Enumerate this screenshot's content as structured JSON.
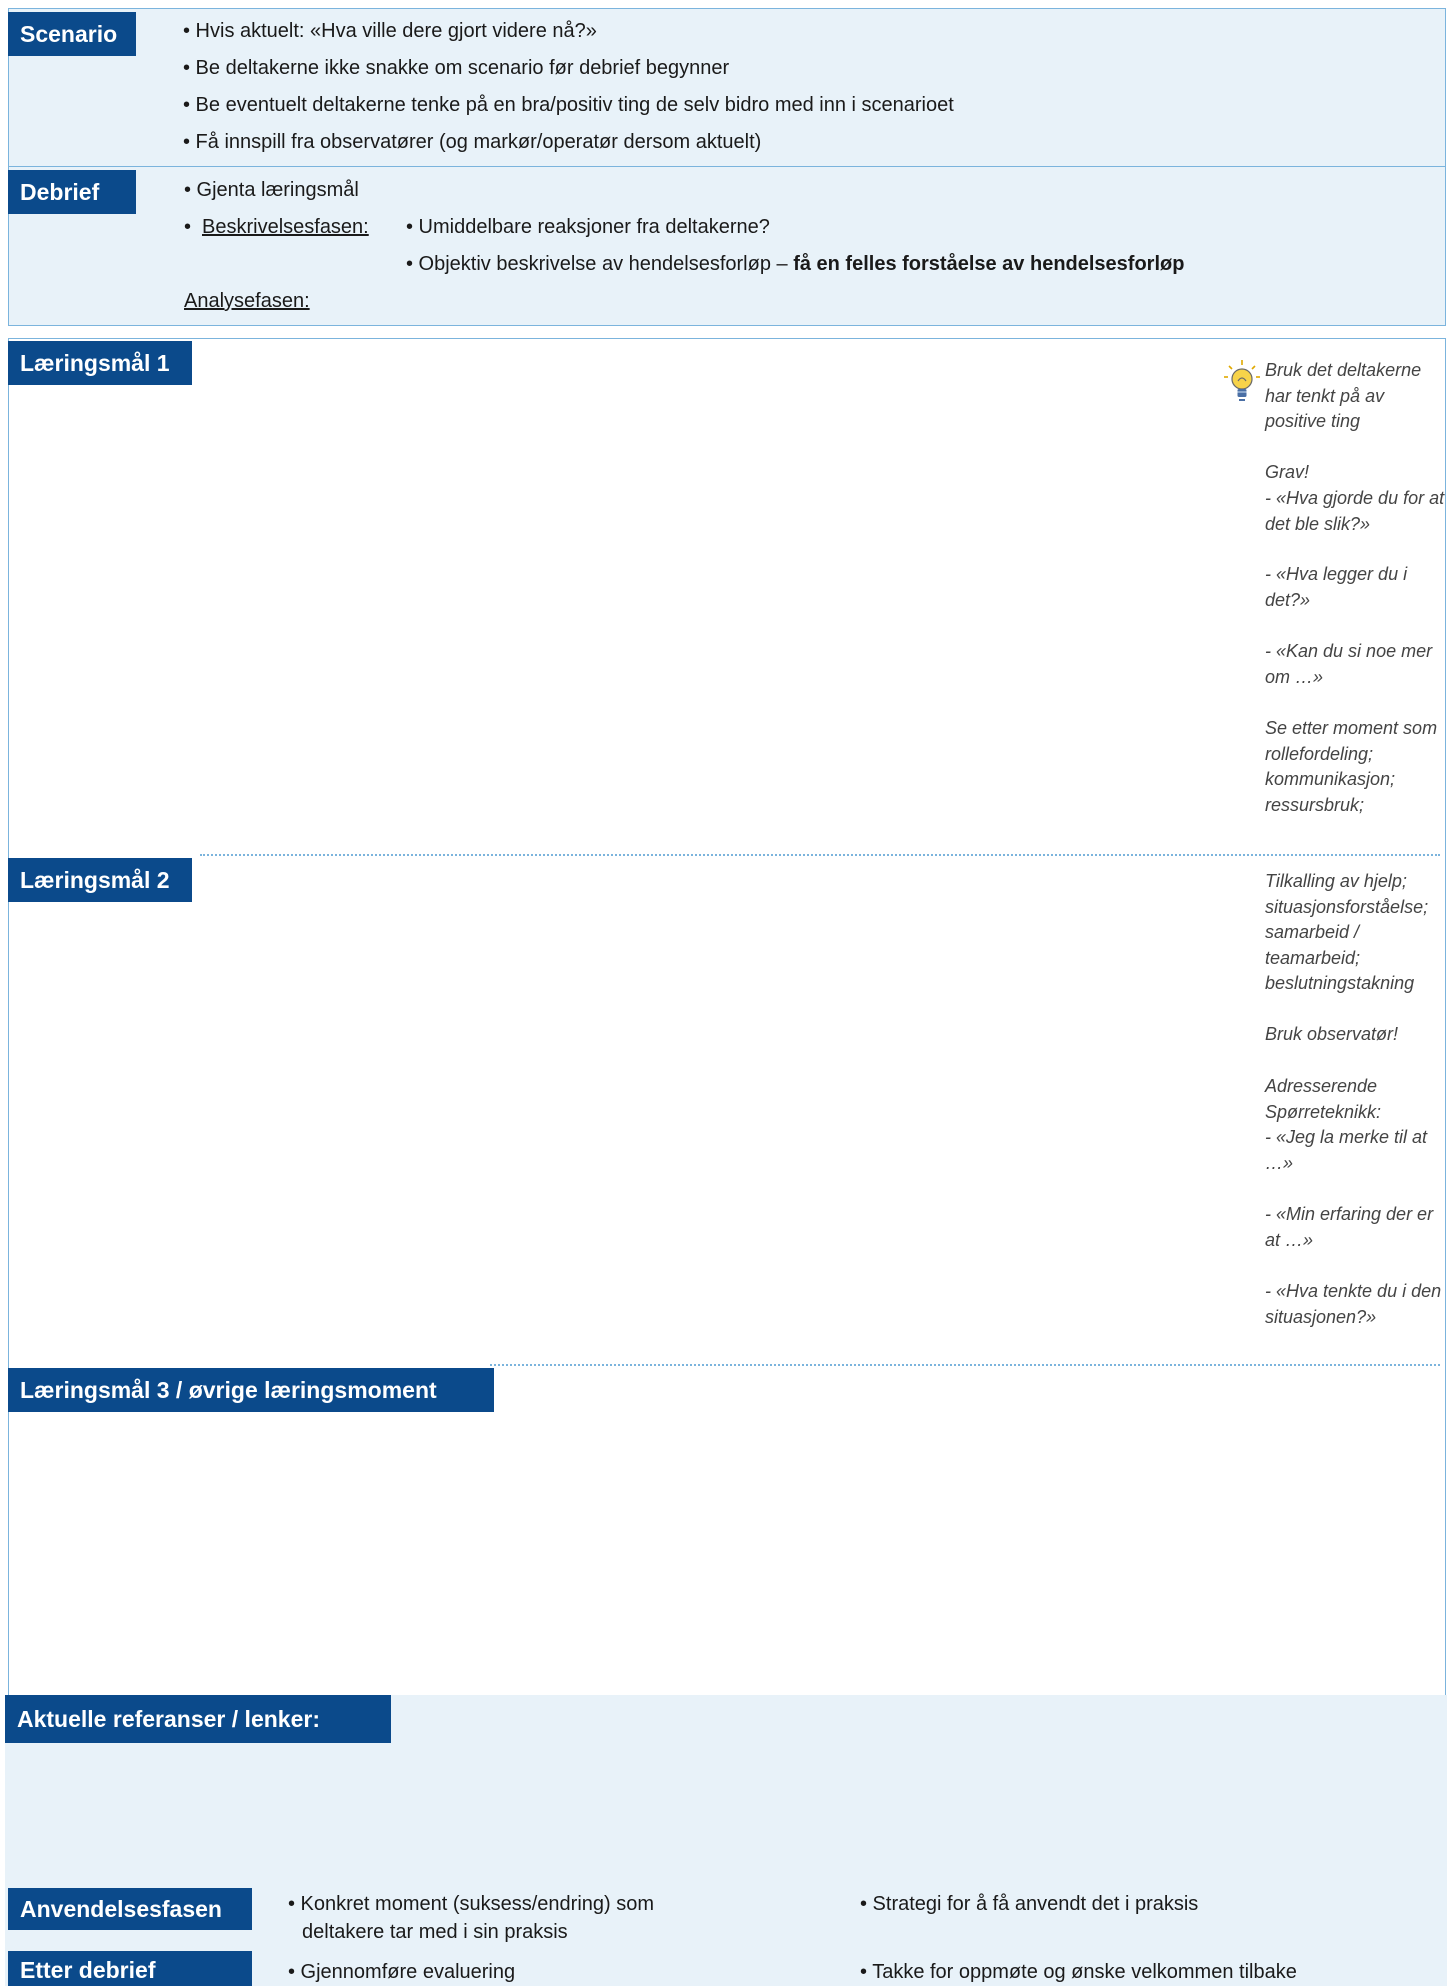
{
  "scenario": {
    "label": "Scenario",
    "items": [
      "• Hvis aktuelt: «Hva ville dere gjort videre nå?»",
      "• Be deltakerne ikke snakke om scenario før debrief begynner",
      "• Be eventuelt deltakerne tenke på en bra/positiv ting de selv bidro med inn i scenarioet",
      "• Få innspill fra observatører (og markør/operatør dersom aktuelt)"
    ]
  },
  "debrief": {
    "label": "Debrief",
    "item1": "•  Gjenta læringsmål",
    "bullet2": "•",
    "beskrivelse_label": "Beskrivelsesfasen:",
    "beskrivelse_items": [
      "• Umiddelbare reaksjoner fra deltakerne?",
      "• Objektiv beskrivelse av hendelsesforløp – "
    ],
    "beskrivelse_bold": "få en felles forståelse av hendelsesforløp",
    "analyse_label": "Analysefasen:"
  },
  "learning_goals": [
    "Læringsmål 1",
    "Læringsmål 2",
    "Læringsmål 3 / øvrige læringsmoment"
  ],
  "side_notes": {
    "icon": "lightbulb-icon",
    "n1": "Bruk det deltakerne har tenkt på av positive ting",
    "grav_label": "Grav!",
    "grav_1": "- «Hva gjorde du for at det ble slik?»",
    "grav_2": "- «Hva legger du i det?»",
    "grav_3": "- «Kan du si noe mer om …»",
    "moment": "Se etter moment som rollefordeling; kommunikasjon; ressursbruk;",
    "moment2": "Tilkalling av hjelp; situasjonsforståelse; samarbeid / teamarbeid; beslutningstakning",
    "observer": "Bruk observatør!",
    "adr_label": "Adresserende Spørreteknikk:",
    "adr_1": "- «Jeg la merke til at …»",
    "adr_2": "- «Min erfaring der er at …»",
    "adr_3": "- «Hva tenkte du i den situasjonen?»"
  },
  "references": {
    "label": "Aktuelle referanser / lenker:"
  },
  "anvendelse": {
    "label": "Anvendelsesfasen",
    "left": "• Konkret moment (suksess/endring) som",
    "left_cont": "deltakere tar med i sin praksis",
    "right": "• Strategi for å få anvendt det i praksis"
  },
  "etter": {
    "label": "Etter debrief",
    "left": "• Gjennomføre evaluering",
    "right": "• Takke for oppmøte og ønske velkommen tilbake"
  },
  "colors": {
    "tab": "#0b4a8b",
    "panel": "#e8f2f9",
    "border": "#7bb4dd"
  }
}
